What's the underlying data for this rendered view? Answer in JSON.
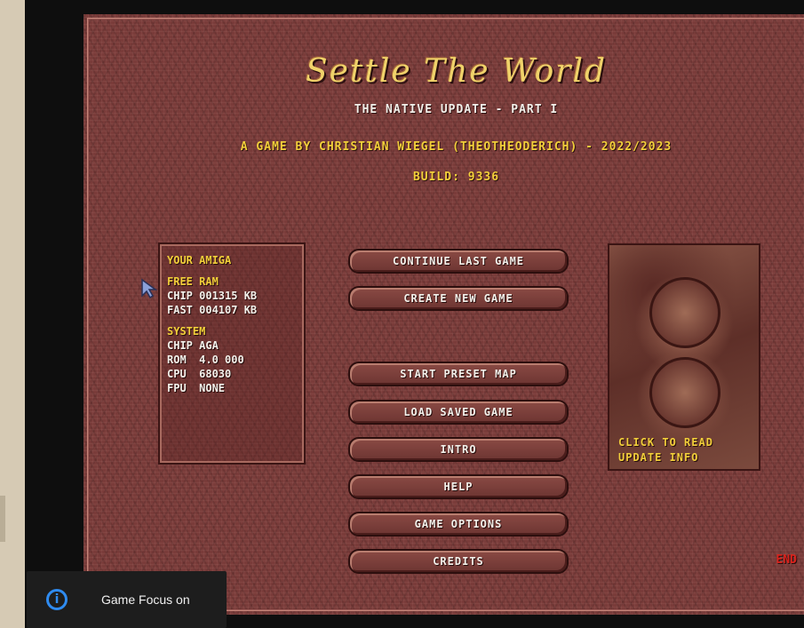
{
  "game": {
    "title": "Settle The World",
    "subtitle": "THE NATIVE UPDATE - PART I",
    "author": "A GAME BY CHRISTIAN WIEGEL (THEOTHEODERICH) - 2022/2023",
    "build": "BUILD: 9336"
  },
  "system_info": {
    "heading": "YOUR AMIGA",
    "free_ram_heading": "FREE RAM",
    "chip_ram": "CHIP 001315 KB",
    "fast_ram": "FAST 004107 KB",
    "system_heading": "SYSTEM",
    "chip": "CHIP AGA",
    "rom": "ROM  4.0 000",
    "cpu": "CPU  68030",
    "fpu": "FPU  NONE"
  },
  "menu": {
    "continue": "CONTINUE LAST GAME",
    "create": "CREATE NEW GAME",
    "preset": "START PRESET MAP",
    "load": "LOAD SAVED GAME",
    "intro": "INTRO",
    "help": "HELP",
    "options": "GAME OPTIONS",
    "credits": "CREDITS"
  },
  "update_box": {
    "line1": "CLICK TO READ",
    "line2": "UPDATE INFO"
  },
  "end_label": "END",
  "toast": {
    "icon": "info-icon",
    "text": "Game Focus on"
  },
  "colors": {
    "background": "#7a3c3a",
    "title": "#f0d26a",
    "accent_yellow": "#f2cf3a",
    "end_red": "#d8221c",
    "toast_bg": "#1d1d1d",
    "toast_icon": "#2f8bf0"
  }
}
